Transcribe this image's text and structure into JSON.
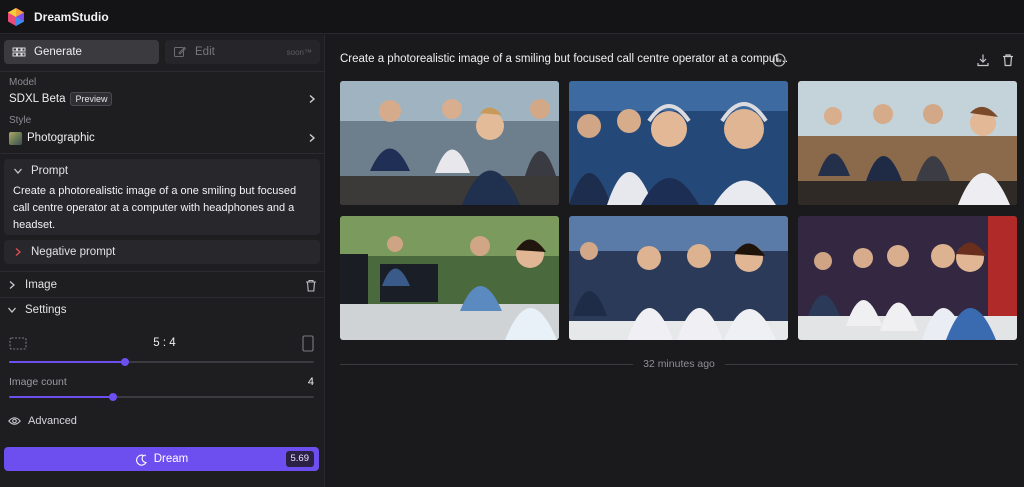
{
  "app": {
    "name": "DreamStudio"
  },
  "sidebar": {
    "tabs": {
      "generate": "Generate",
      "edit": "Edit",
      "edit_note": "soon™"
    },
    "model": {
      "label": "Model",
      "value": "SDXL Beta",
      "badge": "Preview"
    },
    "style": {
      "label": "Style",
      "value": "Photographic"
    },
    "prompt": {
      "label": "Prompt",
      "text": "Create a photorealistic image of a one smiling but focused call centre operator at a computer with headphones and a headset."
    },
    "negative_prompt": {
      "label": "Negative prompt"
    },
    "image": {
      "label": "Image"
    },
    "settings": {
      "label": "Settings"
    },
    "aspect_ratio": {
      "value": "5 : 4",
      "level_fraction": 0.38
    },
    "image_count": {
      "label": "Image count",
      "value": "4",
      "level_fraction": 0.34
    },
    "advanced": {
      "label": "Advanced"
    },
    "dream_button": {
      "label": "Dream",
      "cost": "5.69"
    }
  },
  "main": {
    "prompt_title": "Create a photorealistic image of a smiling but focused call centre operator at a comput...",
    "timestamp": "32 minutes ago",
    "images": [
      {
        "name": "generated-image-1",
        "bg": "#5b6c78"
      },
      {
        "name": "generated-image-2",
        "bg": "#2a4a7a"
      },
      {
        "name": "generated-image-3",
        "bg": "#7a5a3e"
      },
      {
        "name": "generated-image-4",
        "bg": "#3f5a3a"
      },
      {
        "name": "generated-image-5",
        "bg": "#2f4060"
      },
      {
        "name": "generated-image-6",
        "bg": "#3a2a40"
      }
    ]
  },
  "colors": {
    "accent": "#6d4ff0",
    "background": "#1a1a1c",
    "sidebar": "#1e1e21"
  }
}
